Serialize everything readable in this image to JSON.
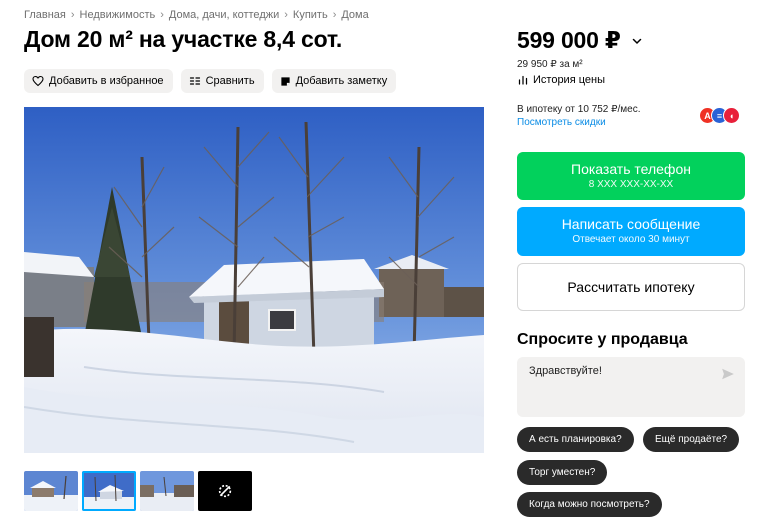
{
  "breadcrumb": [
    "Главная",
    "Недвижимость",
    "Дома, дачи, коттеджи",
    "Купить",
    "Дома"
  ],
  "title": "Дом 20 м² на участке 8,4 сот.",
  "actions": {
    "favorite": "Добавить в избранное",
    "compare": "Сравнить",
    "note": "Добавить заметку"
  },
  "price": {
    "value": "599 000 ₽",
    "per_m": "29 950 ₽ за м²",
    "history": "История цены"
  },
  "mortgage": {
    "text": "В ипотеку от 10 752 ₽/мес.",
    "link": "Посмотреть скидки",
    "banks": [
      {
        "letter": "А",
        "color": "#ef3124"
      },
      {
        "letter": "≡",
        "color": "#2a62d6"
      },
      {
        "letter": "◖",
        "color": "#e8203a"
      }
    ]
  },
  "buttons": {
    "phone": "Показать телефон",
    "phone_sub": "8 XXX XXX-XX-XX",
    "message": "Написать сообщение",
    "message_sub": "Отвечает около 30 минут",
    "calc_mortgage": "Рассчитать ипотеку"
  },
  "ask": {
    "title": "Спросите у продавца",
    "input_value": "Здравствуйте!",
    "chips": [
      "А есть планировка?",
      "Ещё продаёте?",
      "Торг уместен?",
      "Когда можно посмотреть?"
    ]
  },
  "colors": {
    "accent_green": "#02d15c",
    "accent_blue": "#00aaff",
    "link": "#0a8ce5"
  }
}
